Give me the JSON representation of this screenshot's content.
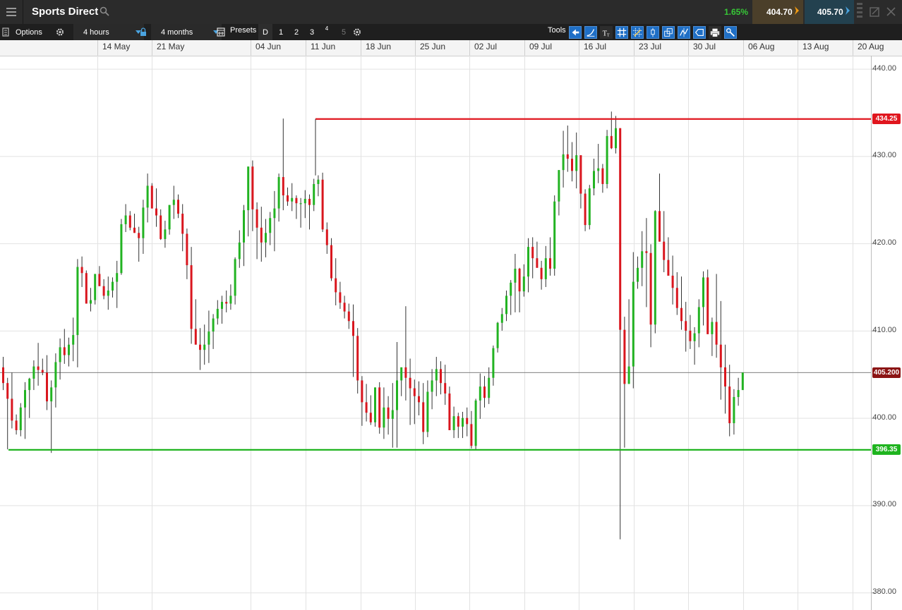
{
  "header": {
    "instrument": "Sports Direct",
    "change_pct": "1.65%",
    "sell_price": "404.70",
    "buy_price": "405.70",
    "change_color": "#37c837",
    "sell_arrow_color": "#f39c12",
    "buy_arrow_color": "#4aa3df",
    "icons": [
      "menu-icon",
      "search-icon",
      "grip-icon",
      "detach-icon",
      "close-icon"
    ]
  },
  "toolbar": {
    "options_label": "Options",
    "interval": "4 hours",
    "range": "4 months",
    "presets_label": "Presets",
    "presets": [
      "D",
      "1",
      "2",
      "3",
      "4",
      "5"
    ],
    "tools_label": "Tools",
    "icons": [
      "options-icon",
      "gear-icon",
      "lock-icon",
      "calendar-icon",
      "gear-icon",
      "back-icon",
      "curve-icon",
      "text-icon",
      "grid-icon",
      "crosshair-icon",
      "candle-icon",
      "compare-icon",
      "indicator-icon",
      "label-icon",
      "print-icon",
      "settings-icon"
    ]
  },
  "chart_data": {
    "type": "candlestick",
    "x_tick_labels": [
      "14 May",
      "21 May",
      "04 Jun",
      "11 Jun",
      "18 Jun",
      "25 Jun",
      "02 Jul",
      "09 Jul",
      "16 Jul",
      "23 Jul",
      "30 Jul",
      "06 Aug",
      "13 Aug",
      "20 Aug"
    ],
    "y_tick_labels": [
      "440.00",
      "430.00",
      "420.00",
      "410.00",
      "400.00",
      "390.00",
      "380.00"
    ],
    "ylim": [
      378,
      441.5
    ],
    "y_ticks": [
      440,
      430,
      420,
      410,
      400,
      390,
      380
    ],
    "resistance": {
      "value": 434.25,
      "label": "434.25",
      "color": "#e0161e"
    },
    "support": {
      "value": 396.35,
      "label": "396.35",
      "color": "#1fb41f"
    },
    "last_price": {
      "value": 405.2,
      "label": "405.200",
      "color": "#8b1414"
    },
    "up_color": "#22b322",
    "down_color": "#d9161e",
    "candles": [
      [
        405.8,
        407.0,
        403.2,
        404.0
      ],
      [
        404.0,
        404.6,
        396.4,
        402.2
      ],
      [
        402.2,
        405.2,
        398.8,
        399.7
      ],
      [
        399.7,
        400.4,
        398.1,
        398.6
      ],
      [
        398.6,
        401.7,
        397.9,
        401.2
      ],
      [
        401.2,
        404.1,
        397.6,
        403.2
      ],
      [
        403.2,
        404.6,
        400.0,
        404.5
      ],
      [
        404.5,
        406.6,
        403.2,
        405.9
      ],
      [
        405.9,
        408.6,
        403.7,
        405.5
      ],
      [
        405.5,
        406.8,
        404.9,
        405.2
      ],
      [
        405.2,
        407.2,
        400.9,
        401.9
      ],
      [
        401.9,
        404.3,
        396.0,
        403.5
      ],
      [
        403.5,
        407.4,
        401.2,
        406.4
      ],
      [
        406.4,
        409.1,
        404.4,
        408.1
      ],
      [
        408.1,
        410.2,
        406.2,
        407.2
      ],
      [
        407.2,
        409.2,
        405.9,
        408.4
      ],
      [
        408.4,
        411.5,
        406.5,
        409.5
      ],
      [
        409.5,
        418.2,
        405.8,
        417.3
      ],
      [
        417.3,
        418.5,
        415.0,
        416.6
      ],
      [
        416.6,
        416.9,
        413.2,
        413.1
      ],
      [
        413.1,
        414.9,
        412.2,
        413.5
      ],
      [
        413.5,
        416.4,
        413.0,
        416.5
      ],
      [
        416.5,
        417.4,
        415.1,
        415.1
      ],
      [
        415.1,
        415.9,
        413.6,
        414.0
      ],
      [
        414.0,
        416.2,
        412.4,
        414.6
      ],
      [
        414.6,
        416.1,
        413.8,
        415.6
      ],
      [
        415.6,
        418.0,
        412.6,
        416.6
      ],
      [
        416.6,
        422.8,
        416.4,
        422.2
      ],
      [
        422.2,
        424.5,
        421.3,
        423.2
      ],
      [
        423.2,
        423.7,
        421.5,
        421.8
      ],
      [
        421.8,
        423.4,
        421.2,
        421.2
      ],
      [
        421.2,
        421.9,
        417.9,
        420.6
      ],
      [
        420.6,
        425.0,
        418.8,
        424.1
      ],
      [
        424.1,
        428.0,
        422.4,
        426.6
      ],
      [
        426.6,
        426.9,
        424.8,
        424.0
      ],
      [
        424.0,
        426.3,
        421.9,
        423.2
      ],
      [
        423.2,
        423.9,
        420.4,
        420.5
      ],
      [
        420.5,
        422.6,
        419.5,
        421.6
      ],
      [
        421.6,
        424.4,
        421.0,
        424.4
      ],
      [
        424.4,
        426.6,
        422.8,
        425.0
      ],
      [
        425.0,
        425.6,
        422.9,
        423.4
      ],
      [
        423.4,
        424.5,
        419.1,
        421.1
      ],
      [
        421.1,
        421.7,
        415.9,
        417.5
      ],
      [
        417.5,
        419.6,
        408.5,
        410.2
      ],
      [
        410.2,
        413.6,
        408.6,
        408.4
      ],
      [
        408.4,
        410.3,
        405.5,
        407.8
      ],
      [
        407.8,
        410.7,
        406.1,
        408.4
      ],
      [
        408.4,
        412.3,
        406.3,
        409.9
      ],
      [
        409.9,
        411.9,
        407.9,
        411.4
      ],
      [
        411.4,
        413.5,
        410.7,
        412.5
      ],
      [
        412.5,
        414.0,
        410.8,
        413.3
      ],
      [
        413.3,
        414.6,
        412.1,
        413.1
      ],
      [
        413.1,
        415.3,
        412.4,
        414.0
      ],
      [
        414.0,
        418.4,
        413.0,
        418.2
      ],
      [
        418.2,
        421.5,
        417.2,
        420.1
      ],
      [
        420.1,
        424.4,
        417.4,
        423.8
      ],
      [
        423.8,
        428.2,
        420.8,
        428.8
      ],
      [
        428.8,
        429.5,
        421.4,
        423.9
      ],
      [
        423.9,
        424.7,
        418.2,
        421.8
      ],
      [
        421.8,
        424.2,
        417.9,
        420.1
      ],
      [
        420.1,
        422.8,
        418.4,
        421.2
      ],
      [
        421.2,
        423.6,
        419.8,
        422.9
      ],
      [
        422.9,
        426.0,
        419.1,
        424.0
      ],
      [
        424.0,
        428.0,
        422.5,
        427.6
      ],
      [
        427.6,
        434.3,
        423.8,
        425.5
      ],
      [
        425.5,
        426.4,
        424.3,
        424.8
      ],
      [
        424.8,
        426.9,
        423.7,
        425.2
      ],
      [
        425.2,
        425.5,
        422.8,
        424.6
      ],
      [
        424.6,
        425.2,
        421.8,
        424.6
      ],
      [
        424.6,
        426.1,
        422.9,
        425.1
      ],
      [
        425.1,
        425.6,
        421.6,
        424.4
      ],
      [
        424.4,
        427.4,
        423.7,
        426.8
      ],
      [
        426.8,
        427.8,
        425.4,
        427.3
      ],
      [
        427.3,
        428.1,
        421.3,
        421.6
      ],
      [
        421.6,
        422.4,
        418.8,
        419.8
      ],
      [
        419.8,
        420.6,
        415.7,
        416.0
      ],
      [
        416.0,
        418.3,
        412.9,
        414.4
      ],
      [
        414.4,
        415.6,
        412.5,
        413.2
      ],
      [
        413.2,
        414.0,
        411.4,
        412.2
      ],
      [
        412.2,
        413.1,
        410.2,
        411.1
      ],
      [
        411.1,
        413.0,
        404.7,
        409.4
      ],
      [
        409.4,
        410.3,
        402.8,
        404.3
      ],
      [
        404.3,
        404.8,
        399.1,
        401.8
      ],
      [
        401.8,
        403.9,
        399.6,
        400.6
      ],
      [
        400.6,
        402.6,
        399.2,
        399.5
      ],
      [
        399.5,
        403.4,
        399.0,
        403.5
      ],
      [
        403.5,
        404.1,
        398.2,
        398.9
      ],
      [
        398.9,
        403.5,
        397.6,
        401.2
      ],
      [
        401.2,
        402.5,
        398.1,
        399.9
      ],
      [
        399.9,
        404.0,
        396.6,
        400.9
      ],
      [
        400.9,
        408.7,
        396.6,
        404.3
      ],
      [
        404.3,
        405.5,
        402.5,
        405.8
      ],
      [
        405.8,
        412.8,
        402.0,
        404.6
      ],
      [
        404.6,
        406.8,
        399.2,
        403.4
      ],
      [
        403.4,
        404.4,
        399.3,
        402.5
      ],
      [
        402.5,
        404.2,
        400.3,
        401.8
      ],
      [
        401.8,
        404.0,
        397.0,
        398.4
      ],
      [
        398.4,
        404.3,
        397.8,
        403.0
      ],
      [
        403.0,
        405.6,
        401.0,
        404.3
      ],
      [
        404.3,
        407.0,
        402.5,
        405.6
      ],
      [
        405.6,
        406.5,
        402.7,
        404.0
      ],
      [
        404.0,
        406.1,
        401.5,
        402.8
      ],
      [
        402.8,
        403.6,
        398.6,
        398.6
      ],
      [
        398.6,
        401.3,
        397.7,
        400.2
      ],
      [
        400.2,
        400.6,
        397.7,
        399.0
      ],
      [
        399.0,
        400.7,
        397.7,
        400.0
      ],
      [
        400.0,
        401.2,
        397.9,
        399.3
      ],
      [
        399.3,
        400.8,
        396.5,
        396.8
      ],
      [
        396.8,
        402.2,
        396.4,
        402.0
      ],
      [
        402.0,
        405.1,
        399.9,
        403.6
      ],
      [
        403.6,
        404.8,
        401.2,
        402.3
      ],
      [
        402.3,
        405.8,
        401.6,
        404.6
      ],
      [
        404.6,
        408.3,
        403.7,
        408.0
      ],
      [
        408.0,
        411.0,
        407.5,
        410.9
      ],
      [
        410.9,
        412.6,
        410.0,
        411.9
      ],
      [
        411.9,
        414.6,
        411.1,
        414.0
      ],
      [
        414.0,
        415.8,
        411.8,
        415.5
      ],
      [
        415.5,
        418.8,
        412.1,
        417.1
      ],
      [
        417.1,
        417.2,
        412.1,
        414.5
      ],
      [
        414.5,
        417.6,
        413.9,
        416.2
      ],
      [
        416.2,
        420.6,
        414.4,
        419.6
      ],
      [
        419.6,
        420.7,
        416.0,
        418.3
      ],
      [
        418.3,
        420.2,
        417.2,
        417.2
      ],
      [
        417.2,
        418.0,
        414.7,
        415.9
      ],
      [
        415.9,
        419.7,
        415.0,
        418.3
      ],
      [
        418.3,
        420.7,
        416.3,
        417.1
      ],
      [
        417.1,
        425.5,
        416.3,
        424.8
      ],
      [
        424.8,
        428.3,
        423.2,
        428.4
      ],
      [
        428.4,
        432.9,
        426.4,
        430.2
      ],
      [
        430.2,
        433.5,
        428.2,
        429.7
      ],
      [
        429.7,
        431.6,
        427.1,
        428.3
      ],
      [
        428.3,
        432.7,
        426.3,
        430.1
      ],
      [
        430.1,
        429.9,
        424.0,
        425.7
      ],
      [
        425.7,
        426.2,
        421.4,
        422.1
      ],
      [
        422.1,
        426.7,
        421.6,
        426.3
      ],
      [
        426.3,
        429.7,
        425.5,
        428.3
      ],
      [
        428.3,
        431.4,
        426.9,
        428.6
      ],
      [
        428.6,
        429.1,
        425.8,
        426.8
      ],
      [
        426.8,
        433.0,
        426.3,
        432.3
      ],
      [
        432.3,
        435.1,
        430.8,
        430.9
      ],
      [
        430.9,
        434.6,
        430.3,
        433.2
      ],
      [
        433.2,
        427.4,
        386.1,
        410.1
      ],
      [
        410.1,
        411.6,
        396.6,
        403.9
      ],
      [
        403.9,
        413.6,
        404.0,
        405.9
      ],
      [
        405.9,
        419.0,
        403.4,
        415.6
      ],
      [
        415.6,
        418.5,
        414.8,
        417.2
      ],
      [
        417.2,
        421.4,
        415.1,
        419.1
      ],
      [
        419.1,
        422.9,
        412.7,
        418.9
      ],
      [
        418.9,
        419.9,
        408.1,
        410.7
      ],
      [
        410.7,
        423.8,
        409.7,
        423.7
      ],
      [
        423.7,
        428.0,
        420.2,
        420.2
      ],
      [
        420.2,
        423.7,
        416.7,
        418.1
      ],
      [
        418.1,
        420.7,
        416.6,
        416.3
      ],
      [
        416.3,
        418.6,
        413.0,
        414.9
      ],
      [
        414.9,
        416.7,
        411.8,
        412.6
      ],
      [
        412.6,
        416.2,
        410.1,
        411.1
      ],
      [
        411.1,
        413.3,
        407.6,
        410.0
      ],
      [
        410.0,
        411.8,
        407.9,
        408.8
      ],
      [
        408.8,
        410.4,
        406.1,
        409.7
      ],
      [
        409.7,
        413.6,
        408.1,
        412.7
      ],
      [
        412.7,
        416.8,
        410.6,
        416.1
      ],
      [
        416.1,
        417.0,
        411.9,
        409.6
      ],
      [
        409.6,
        411.5,
        407.1,
        411.0
      ],
      [
        411.0,
        416.5,
        406.9,
        408.4
      ],
      [
        408.4,
        413.4,
        402.1,
        405.8
      ],
      [
        405.8,
        408.4,
        400.5,
        403.6
      ],
      [
        403.6,
        406.1,
        397.9,
        399.4
      ],
      [
        399.4,
        403.3,
        398.1,
        402.4
      ],
      [
        402.4,
        404.6,
        401.4,
        403.2
      ],
      [
        403.2,
        403.8,
        405.2,
        405.2
      ]
    ]
  }
}
